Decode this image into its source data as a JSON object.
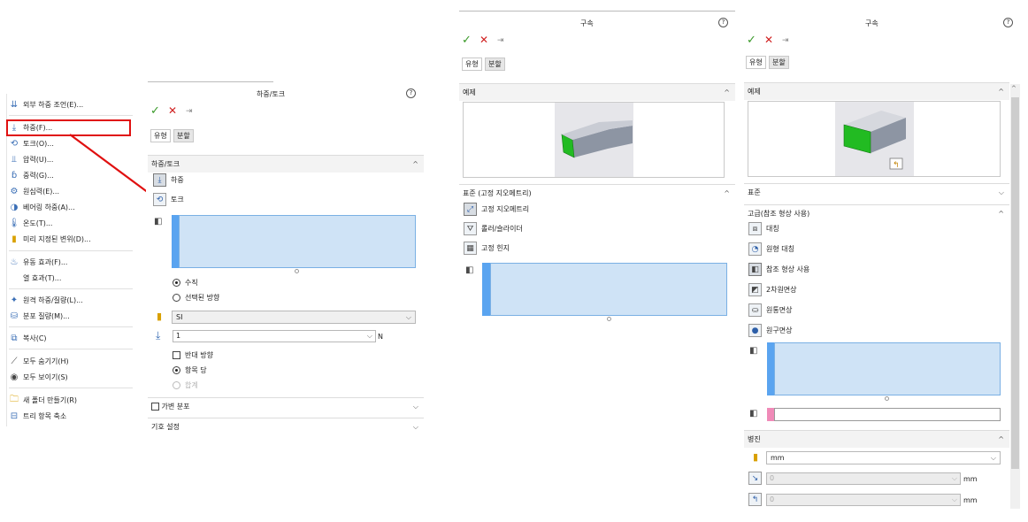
{
  "context_menu": {
    "items": [
      {
        "label": "외부 하중 조언(E)...",
        "icon": "external-load-advisor-icon"
      },
      {
        "label": "하중(F)...",
        "icon": "force-icon"
      },
      {
        "label": "토크(O)...",
        "icon": "torque-icon"
      },
      {
        "label": "압력(U)...",
        "icon": "pressure-icon"
      },
      {
        "label": "중력(G)...",
        "icon": "gravity-icon"
      },
      {
        "label": "원심력(E)...",
        "icon": "centrifugal-icon"
      },
      {
        "label": "베어링 하중(A)...",
        "icon": "bearing-load-icon"
      },
      {
        "label": "온도(T)...",
        "icon": "temperature-icon"
      },
      {
        "label": "미리 지정된 변위(D)...",
        "icon": "prescribed-displacement-icon"
      },
      {
        "label": "유동 효과(F)...",
        "icon": "flow-effect-icon"
      },
      {
        "label": "열 효과(T)...",
        "icon": ""
      },
      {
        "label": "원격 하중/질량(L)...",
        "icon": "remote-load-icon"
      },
      {
        "label": "분포 질량(M)...",
        "icon": "distributed-mass-icon"
      },
      {
        "label": "복사(C)",
        "icon": "copy-icon"
      },
      {
        "label": "모두 숨기기(H)",
        "icon": "hide-all-icon"
      },
      {
        "label": "모두 보이기(S)",
        "icon": "show-all-icon"
      },
      {
        "label": "새 폴더 만들기(R)",
        "icon": "new-folder-icon"
      },
      {
        "label": "트리 항목 축소",
        "icon": "collapse-tree-icon"
      }
    ],
    "highlight_color": "#e01010"
  },
  "force_panel": {
    "title": "하중/토크",
    "tabs": [
      "유형",
      "분할"
    ],
    "section_title": "하중/토크",
    "type_force": "하중",
    "type_torque": "토크",
    "direction_normal": "수직",
    "direction_selected": "선택된 방향",
    "units": "SI",
    "value": "1",
    "value_unit": "N",
    "reverse": "반대 방향",
    "per_item": "항목 당",
    "total": "합계",
    "nonuniform": "가변 분포",
    "symbol_settings": "기호 설정"
  },
  "fixture_panel": {
    "title": "구속",
    "tabs": [
      "유형",
      "분할"
    ],
    "example_section": "예제",
    "standard_section": "표준 (고정 지오메트리)",
    "fixed_geometry": "고정 지오메트리",
    "roller_slider": "롤러/슬라이더",
    "fixed_hinge": "고정 힌지"
  },
  "fixture_adv_panel": {
    "title": "구속",
    "tabs": [
      "유형",
      "분할"
    ],
    "example_section": "예제",
    "standard_section": "표준",
    "advanced_section": "고급(참조 형상 사용)",
    "symmetry": "대칭",
    "circular_symmetry": "원형 대칭",
    "use_reference": "참조 형상 사용",
    "on_flat_faces": "2차원면상",
    "on_cylindrical_faces": "원통면상",
    "on_spherical_faces": "원구면상",
    "translations_section": "병진",
    "units": "mm",
    "val1": "0",
    "val2": "0",
    "unit1": "mm",
    "unit2": "mm"
  },
  "colors": {
    "selection_fill": "#cfe3f6",
    "selection_strip": "#5aa4f0",
    "green_face": "#22bb22",
    "pink_strip": "#f08ab8",
    "arrow_red": "#e01010"
  }
}
